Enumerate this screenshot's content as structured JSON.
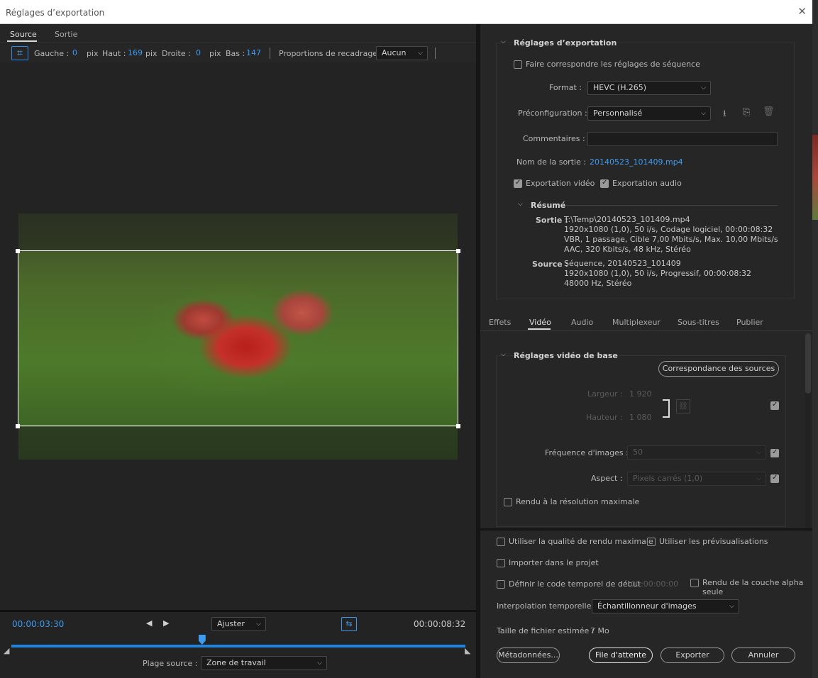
{
  "window": {
    "title": "Réglages d’exportation",
    "close": "✕"
  },
  "left": {
    "tabs": [
      {
        "label": "Source"
      },
      {
        "label": "Sortie"
      }
    ],
    "crop": {
      "gauche_label": "Gauche :",
      "gauche_value": "0",
      "pix": "pix",
      "haut_label": "Haut :",
      "haut_value": "169",
      "droite_label": "Droite :",
      "droite_value": "0",
      "bas_label": "Bas :",
      "bas_value": "147",
      "proportions_label": "Proportions de recadrage :",
      "proportions_value": "Aucun"
    },
    "timeline": {
      "current": "00:00:03:30",
      "duration": "00:00:08:32",
      "fit": "Ajuster",
      "plage_label": "Plage source :",
      "plage_value": "Zone de travail",
      "playhead_fraction": 0.42
    }
  },
  "export": {
    "header": "Réglages d’exportation",
    "match_seq": "Faire correspondre les réglages de séquence",
    "format_label": "Format :",
    "format_value": "HEVC (H.265)",
    "preset_label": "Préconfiguration :",
    "preset_value": "Personnalisé",
    "comments_label": "Commentaires :",
    "comments_value": "",
    "output_label": "Nom de la sortie :",
    "output_value": "20140523_101409.mp4",
    "export_video": "Exportation vidéo",
    "export_audio": "Exportation audio",
    "resume": {
      "header": "Résumé",
      "sortie_label": "Sortie :",
      "sortie_lines": [
        "T:\\Temp\\20140523_101409.mp4",
        "1920x1080 (1,0), 50 i/s, Codage logiciel, 00:00:08:32",
        "VBR, 1 passage, Cible 7,00  Mbits/s, Max. 10,00  Mbits/s",
        "AAC, 320  Kbits/s, 48  kHz, Stéréo"
      ],
      "source_label": "Source :",
      "source_lines": [
        "Séquence, 20140523_101409",
        "1920x1080 (1,0), 50  i/s, Progressif, 00:00:08:32",
        "48000 Hz, Stéréo"
      ]
    }
  },
  "tabs2": [
    {
      "label": "Effets"
    },
    {
      "label": "Vidéo"
    },
    {
      "label": "Audio"
    },
    {
      "label": "Multiplexeur"
    },
    {
      "label": "Sous-titres"
    },
    {
      "label": "Publier"
    }
  ],
  "video": {
    "header": "Réglages vidéo de base",
    "match_sources": "Correspondance des sources",
    "width_label": "Largeur :",
    "width_value": "1 920",
    "height_label": "Hauteur :",
    "height_value": "1 080",
    "fps_label": "Fréquence d'images :",
    "fps_value": "50",
    "aspect_label": "Aspect :",
    "aspect_value": "Pixels carrés (1,0)",
    "maxres": "Rendu à la résolution maximale"
  },
  "bottom": {
    "max_quality": "Utiliser la qualité de rendu maximale",
    "use_previews": "Utiliser les prévisualisations",
    "import_project": "Importer dans le projet",
    "set_tc": "Définir le code temporel de début",
    "tc_value": "00:00:00:00",
    "alpha": "Rendu de la couche alpha seule",
    "interp_label": "Interpolation temporelle :",
    "interp_value": "Échantillonneur d'images",
    "size_label": "Taille de fichier estimée :",
    "size_value": "7 Mo",
    "metadata": "Métadonnées...",
    "queue": "File d'attente",
    "export": "Exporter",
    "cancel": "Annuler"
  }
}
